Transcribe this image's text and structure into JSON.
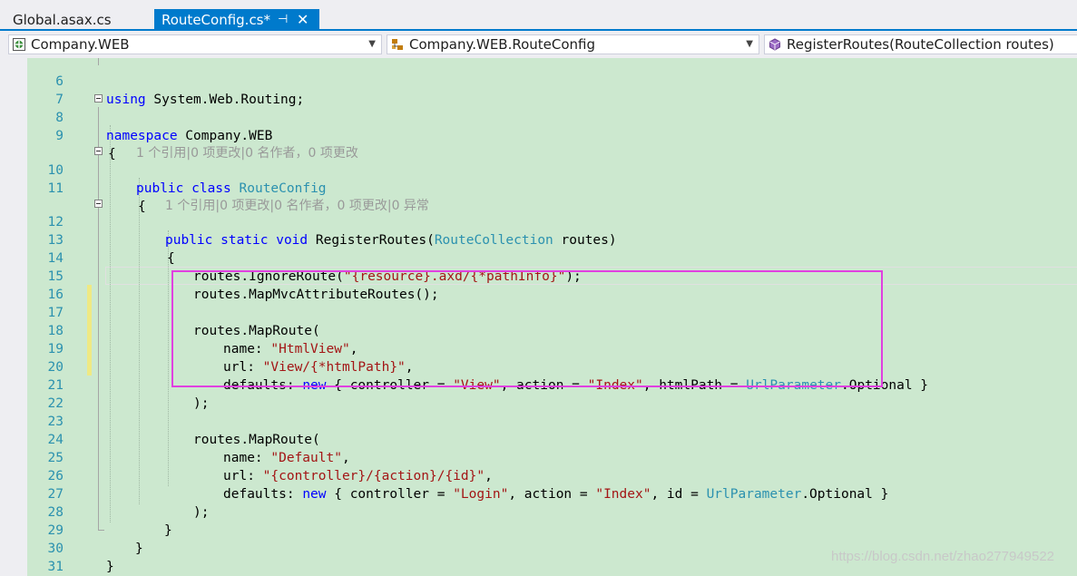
{
  "tabs": [
    {
      "label": "Global.asax.cs",
      "active": false
    },
    {
      "label": "RouteConfig.cs*",
      "active": true,
      "pin_glyph": "⊣",
      "close_glyph": "✕"
    }
  ],
  "navbar": {
    "project": "Company.WEB",
    "type": "Company.WEB.RouteConfig",
    "member": "RegisterRoutes(RouteCollection routes)"
  },
  "lens": {
    "class_refs": "1 个引用|0 项更改|0 名作者，0 项更改",
    "method_refs": "1 个引用|0 项更改|0 名作者，0 项更改|0 异常"
  },
  "code": {
    "l6_kw": "using",
    "l6_rest": " System.Web.Routing;",
    "l8_kw": "namespace",
    "l8_rest": " Company.WEB",
    "brace_open": "{",
    "brace_close": "}",
    "l10_kw": "public class",
    "l10_type": "RouteConfig",
    "l12_kw": "public static void",
    "l12_name": " RegisterRoutes(",
    "l12_type": "RouteCollection",
    "l12_rest": " routes)",
    "l14_a": "routes.IgnoreRoute(",
    "l14_str": "\"{resource}.axd/{*pathInfo}\"",
    "l14_b": ");",
    "l15": "routes.MapMvcAttributeRoutes();",
    "maproute": "routes.MapRoute(",
    "name_key": "name: ",
    "url_key": "url: ",
    "defaults_key": "defaults: ",
    "new_kw": "new",
    "close_paren": ");",
    "comma": ",",
    "l18_str": "\"HtmlView\"",
    "l19_str": "\"View/{*htmlPath}\"",
    "l20_a": " { controller = ",
    "l20_str1": "\"View\"",
    "l20_b": ", action = ",
    "l20_str2": "\"Index\"",
    "l20_c": ", htmlPath = ",
    "l20_type": "UrlParameter",
    "l20_d": ".Optional }",
    "l24_str": "\"Default\"",
    "l25_str": "\"{controller}/{action}/{id}\"",
    "l26_a": " { controller = ",
    "l26_str1": "\"Login\"",
    "l26_b": ", action = ",
    "l26_str2": "\"Index\"",
    "l26_c": ", id = ",
    "l26_type": "UrlParameter",
    "l26_d": ".Optional }"
  },
  "line_numbers": [
    "6",
    "7",
    "8",
    "9",
    "10",
    "11",
    "12",
    "13",
    "14",
    "15",
    "16",
    "17",
    "18",
    "19",
    "20",
    "21",
    "22",
    "23",
    "24",
    "25",
    "26",
    "27",
    "28",
    "29",
    "30",
    "31"
  ],
  "watermark": "https://blog.csdn.net/zhao277949522",
  "colors": {
    "editor_bg": "#cce8cf",
    "keyword": "#0000ff",
    "type": "#2b91af",
    "string": "#a31515",
    "highlight_box": "#e040e0",
    "active_tab": "#007acc"
  }
}
